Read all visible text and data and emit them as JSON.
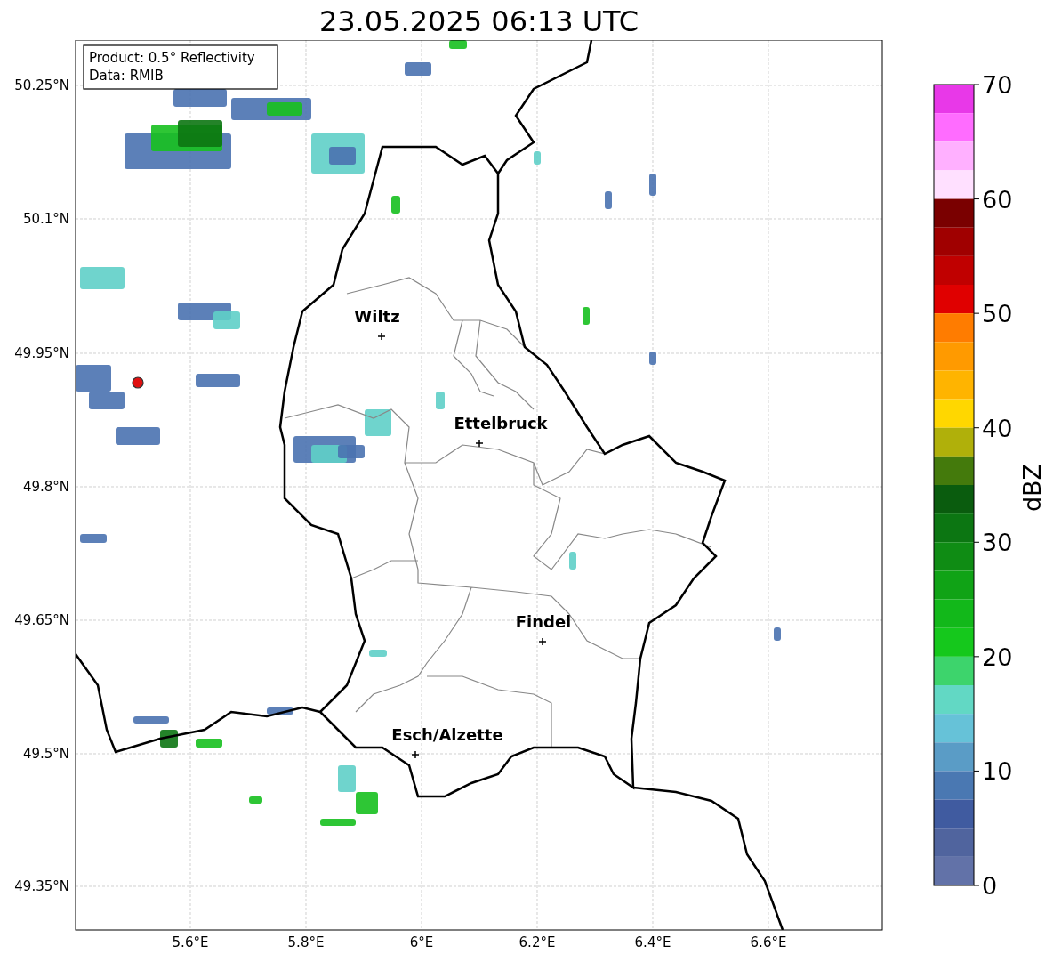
{
  "title": "23.05.2025 06:13 UTC",
  "info_box": [
    "Product: 0.5° Reflectivity",
    "Data: RMIB"
  ],
  "map": {
    "lat_ticks": [
      "50.25°N",
      "50.1°N",
      "49.95°N",
      "49.8°N",
      "49.65°N",
      "49.5°N",
      "49.35°N"
    ],
    "lon_ticks": [
      "5.6°E",
      "5.8°E",
      "6°E",
      "6.2°E",
      "6.4°E",
      "6.6°E"
    ],
    "cities": [
      {
        "name": "Wiltz"
      },
      {
        "name": "Ettelbruck"
      },
      {
        "name": "Findel"
      },
      {
        "name": "Esch/Alzette"
      }
    ]
  },
  "colorbar": {
    "label": "dBZ",
    "ticks": [
      "70",
      "60",
      "50",
      "40",
      "30",
      "20",
      "10",
      "0"
    ],
    "segments": [
      {
        "color": "#e838e8"
      },
      {
        "color": "#ff6cff"
      },
      {
        "color": "#ffb0ff"
      },
      {
        "color": "#ffe0ff"
      },
      {
        "color": "#7a0000"
      },
      {
        "color": "#a00000"
      },
      {
        "color": "#c00000"
      },
      {
        "color": "#e00000"
      },
      {
        "color": "#ff7c00"
      },
      {
        "color": "#ff9a00"
      },
      {
        "color": "#ffb400"
      },
      {
        "color": "#ffd700"
      },
      {
        "color": "#b0b00a"
      },
      {
        "color": "#447a0c"
      },
      {
        "color": "#0a5c0e"
      },
      {
        "color": "#0c7612"
      },
      {
        "color": "#0f8c14"
      },
      {
        "color": "#10a316"
      },
      {
        "color": "#12b81a"
      },
      {
        "color": "#15c81c"
      },
      {
        "color": "#3dd46c"
      },
      {
        "color": "#62d8c4"
      },
      {
        "color": "#66c2d8"
      },
      {
        "color": "#5a9cc6"
      },
      {
        "color": "#4a78b2"
      },
      {
        "color": "#405ba0"
      },
      {
        "color": "#50649e"
      },
      {
        "color": "#6272a8"
      }
    ]
  }
}
